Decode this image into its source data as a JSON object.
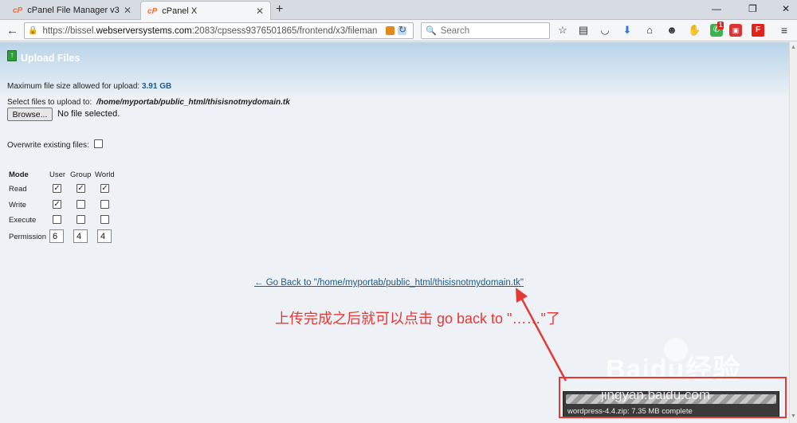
{
  "browser": {
    "tabs": [
      {
        "label": "cPanel File Manager v3",
        "active": false
      },
      {
        "label": "cPanel X",
        "active": true
      }
    ],
    "url_prefix": "https://bissel.",
    "url_host": "webserversystems.com",
    "url_suffix": ":2083/cpsess9376501865/frontend/x3/fileman",
    "search_placeholder": "Search",
    "notification_count": "1",
    "toolbar_icons": [
      "star-icon",
      "reader-icon",
      "pocket-icon",
      "download-icon",
      "home-icon",
      "smiley-icon",
      "hand-icon",
      "whatsapp-icon",
      "ext-icon",
      "flipboard-icon",
      "menu-icon"
    ]
  },
  "page": {
    "title": "Upload Files",
    "max_size_label": "Maximum file size allowed for upload:",
    "max_size_value": "3.91 GB",
    "select_label": "Select files to upload to:",
    "select_path": "/home/myportab/public_html/thisisnotmydomain.tk",
    "browse_label": "Browse...",
    "no_file_text": "No file selected.",
    "overwrite_label": "Overwrite existing files:",
    "overwrite_checked": false,
    "permissions": {
      "headers": [
        "Mode",
        "User",
        "Group",
        "World"
      ],
      "rows": [
        {
          "label": "Read",
          "checks": [
            true,
            true,
            true
          ]
        },
        {
          "label": "Write",
          "checks": [
            true,
            false,
            false
          ]
        },
        {
          "label": "Execute",
          "checks": [
            false,
            false,
            false
          ]
        }
      ],
      "permission_label": "Permission",
      "values": [
        "6",
        "4",
        "4"
      ]
    },
    "go_back_text": "← Go Back to \"/home/myportab/public_html/thisisnotmydomain.tk\""
  },
  "annotation": {
    "text": "上传完成之后就可以点击 go back to \"……\"了",
    "color": "#e53935"
  },
  "download": {
    "filename_status": "wordpress-4.4.zip: 7.35 MB complete"
  },
  "watermark": {
    "main": "Baidu经验",
    "sub": "jingyan.baidu.com"
  }
}
